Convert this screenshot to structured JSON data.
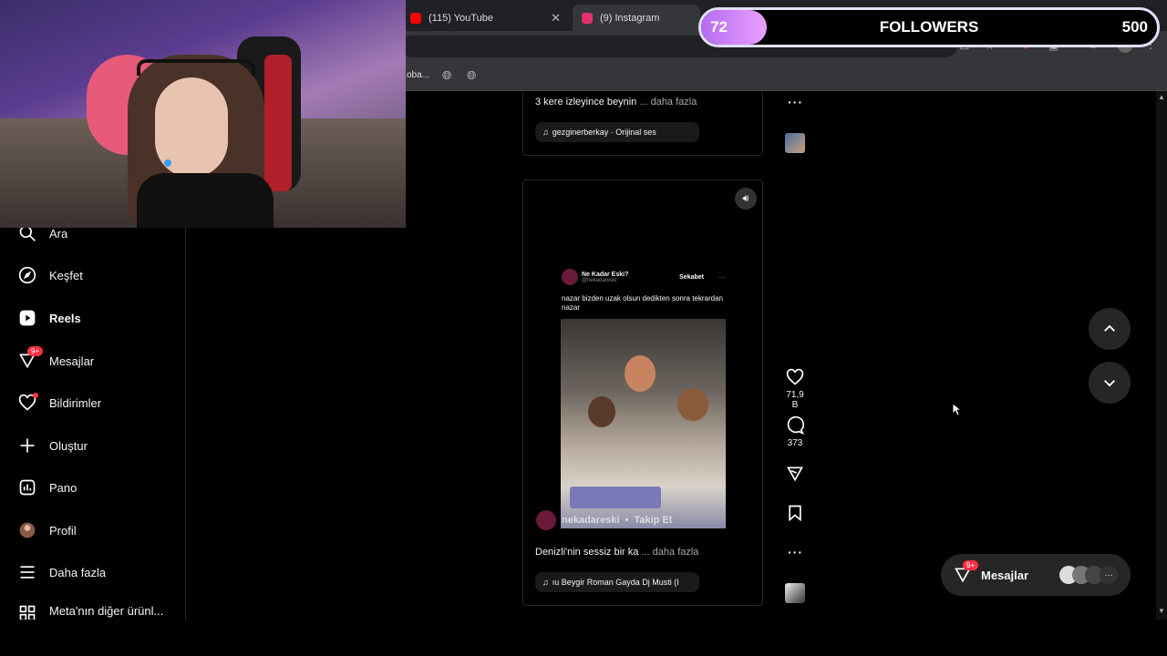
{
  "browser": {
    "tabs": [
      {
        "label": "(115) YouTube",
        "active": false,
        "favicon_color": "#ff0000"
      },
      {
        "label": "(9) Instagram",
        "active": true,
        "favicon_color": "#e1306c"
      }
    ],
    "bookmark_fragment": "oba..."
  },
  "followers_goal": {
    "current": "72",
    "label": "FOLLOWERS",
    "target": "500",
    "progress": 0.144
  },
  "sidebar": {
    "items": [
      {
        "label": "Ara",
        "icon": "search-icon"
      },
      {
        "label": "Keşfet",
        "icon": "compass-icon"
      },
      {
        "label": "Reels",
        "icon": "reels-icon"
      },
      {
        "label": "Mesajlar",
        "icon": "messenger-icon",
        "badge": "9+"
      },
      {
        "label": "Bildirimler",
        "icon": "heart-icon"
      },
      {
        "label": "Oluştur",
        "icon": "plus-icon"
      },
      {
        "label": "Pano",
        "icon": "dashboard-icon"
      },
      {
        "label": "Profil",
        "icon": "avatar-icon"
      },
      {
        "label": "Daha fazla",
        "icon": "menu-icon"
      },
      {
        "label": "Meta'nın diğer ürünl...",
        "icon": "meta-apps-icon"
      }
    ]
  },
  "reel_top": {
    "caption": "3 kere izleyince beynin",
    "more": "... daha fazla",
    "audio": "gezginerberkay · Orijinal ses"
  },
  "reel_main": {
    "tweet_name": "Ne Kadar Eski?",
    "tweet_handle": "@nekadareski",
    "tweet_brand": "Sekabet",
    "tweet_text": "nazar bizden uzak olsun dedikten sonra tekrardan nazar",
    "overlay_user": "nekadareski",
    "overlay_follow": "Takip Et",
    "caption": "Denizli'nin sessiz bir ka",
    "more": "... daha fazla",
    "audio": "ıu Beygir Roman Gayda Dj Musti (I",
    "likes": "71,9 B",
    "comments": "373"
  },
  "messages_pill": {
    "label": "Mesajlar",
    "badge": "9+"
  },
  "colors": {
    "accent_red": "#ff3040",
    "bg": "#000000",
    "goal_fill": "#c77dff"
  }
}
